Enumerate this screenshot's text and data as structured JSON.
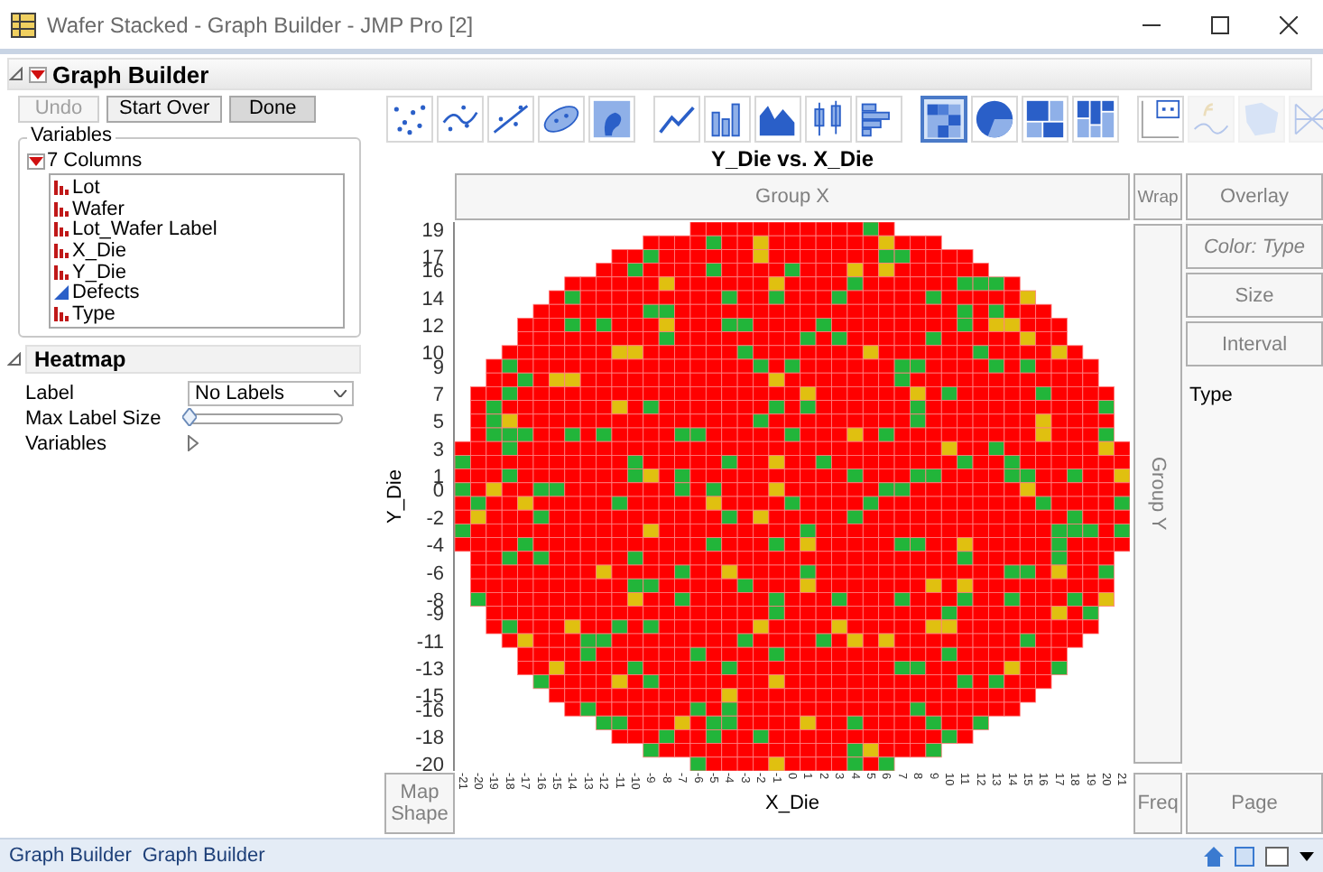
{
  "window": {
    "title": "Wafer Stacked - Graph Builder - JMP Pro [2]"
  },
  "panel": {
    "title": "Graph Builder"
  },
  "buttons": [
    {
      "label": "Undo",
      "disabled": true
    },
    {
      "label": "Start Over",
      "disabled": false
    },
    {
      "label": "Done",
      "disabled": false
    }
  ],
  "variables": {
    "title": "Variables",
    "columns_label": "7 Columns",
    "items": [
      {
        "name": "Lot",
        "kind": "nominal"
      },
      {
        "name": "Wafer",
        "kind": "nominal"
      },
      {
        "name": "Lot_Wafer Label",
        "kind": "nominal"
      },
      {
        "name": "X_Die",
        "kind": "nominal"
      },
      {
        "name": "Y_Die",
        "kind": "nominal"
      },
      {
        "name": "Defects",
        "kind": "continuous"
      },
      {
        "name": "Type",
        "kind": "nominal"
      }
    ]
  },
  "heatmap": {
    "title": "Heatmap",
    "label_field": {
      "label": "Label",
      "value": "No Labels"
    },
    "max_label_size": {
      "label": "Max Label Size",
      "level": 0
    },
    "variables_label": "Variables"
  },
  "toolbar": [
    {
      "selected": false,
      "disabled": false
    },
    {
      "selected": false,
      "disabled": false
    },
    {
      "selected": false,
      "disabled": false
    },
    {
      "selected": false,
      "disabled": false
    },
    {
      "selected": false,
      "disabled": false
    },
    {
      "selected": false,
      "disabled": false
    },
    {
      "selected": false,
      "disabled": false
    },
    {
      "selected": false,
      "disabled": false
    },
    {
      "selected": false,
      "disabled": false
    },
    {
      "selected": false,
      "disabled": false
    },
    {
      "selected": true,
      "disabled": false
    },
    {
      "selected": false,
      "disabled": false
    },
    {
      "selected": false,
      "disabled": false
    },
    {
      "selected": false,
      "disabled": false
    },
    {
      "selected": false,
      "disabled": false
    },
    {
      "selected": false,
      "disabled": true
    },
    {
      "selected": false,
      "disabled": true
    },
    {
      "selected": false,
      "disabled": true
    }
  ],
  "chart": {
    "title": "Y_Die vs. X_Die",
    "xlabel": "X_Die",
    "ylabel": "Y_Die",
    "yticks": [
      "19",
      "17",
      "16",
      "14",
      "12",
      "10",
      "9",
      "7",
      "5",
      "3",
      "1",
      "0",
      "-2",
      "-4",
      "-6",
      "-8",
      "-9",
      "-11",
      "-13",
      "-15",
      "-16",
      "-18",
      "-20"
    ],
    "xticks": [
      "-21",
      "-20",
      "-19",
      "-18",
      "-17",
      "-16",
      "-15",
      "-14",
      "-13",
      "-12",
      "-11",
      "-10",
      "-9",
      "-8",
      "-7",
      "-6",
      "-5",
      "-4",
      "-3",
      "-2",
      "-1",
      "0",
      "1",
      "2",
      "3",
      "4",
      "5",
      "6",
      "7",
      "8",
      "9",
      "10",
      "11",
      "12",
      "13",
      "14",
      "15",
      "16",
      "17",
      "18",
      "19",
      "20",
      "21"
    ]
  },
  "zones": {
    "group_x": "Group X",
    "wrap": "Wrap",
    "overlay": "Overlay",
    "group_y": "Group Y",
    "color_zone": "Color: Type",
    "size": "Size",
    "interval": "Interval",
    "map_shape": "Map Shape",
    "freq": "Freq",
    "page": "Page"
  },
  "legend_title": "Type",
  "status_bar": [
    "Graph Builder",
    "Graph Builder"
  ]
}
